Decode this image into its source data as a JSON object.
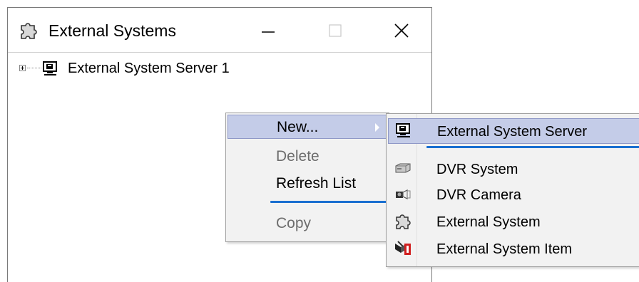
{
  "window": {
    "title": "External Systems",
    "icon": "puzzle-icon",
    "controls": [
      "minimize-icon",
      "maximize-icon",
      "close-icon"
    ]
  },
  "tree": {
    "nodes": [
      {
        "label": "External System Server 1",
        "icon": "server-monitor-icon",
        "expanded": false
      }
    ]
  },
  "context_menu": {
    "items": [
      {
        "label": "New...",
        "enabled": true,
        "highlighted": true,
        "has_submenu": true
      },
      {
        "label": "Delete",
        "enabled": false
      },
      {
        "label": "Refresh List",
        "enabled": true
      },
      {
        "label": "Copy",
        "enabled": false
      }
    ]
  },
  "submenu": {
    "items": [
      {
        "label": "External System Server",
        "icon": "server-monitor-icon",
        "highlighted": true
      },
      {
        "label": "DVR System",
        "icon": "dvr-device-icon"
      },
      {
        "label": "DVR Camera",
        "icon": "camera-icon"
      },
      {
        "label": "External System",
        "icon": "puzzle-icon"
      },
      {
        "label": "External System Item",
        "icon": "system-item-icon"
      }
    ]
  },
  "colors": {
    "highlight": "#c4cce8",
    "separator": "#1a6fd0",
    "disabled_text": "#6d6d6d",
    "menu_bg": "#f2f2f2"
  }
}
